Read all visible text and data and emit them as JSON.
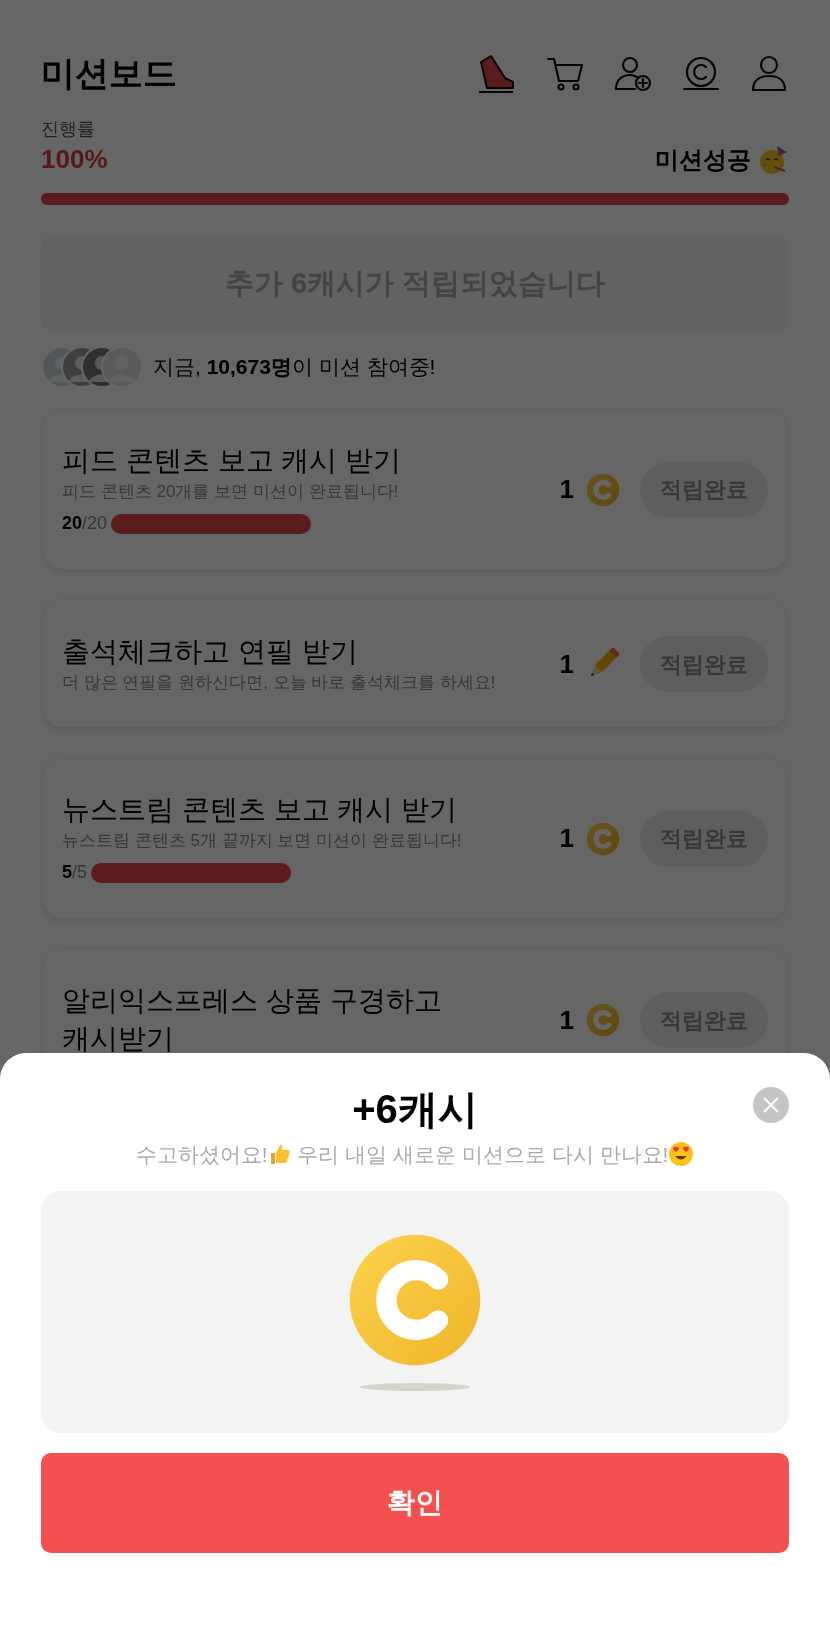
{
  "header": {
    "title": "미션보드"
  },
  "progress": {
    "label": "진행률",
    "value": "100%",
    "status": "미션성공",
    "level": 1
  },
  "banner": "추가 6캐시가 적립되었습니다",
  "participants": "지금, **10,673명**이 미션 참여중!",
  "missions": [
    {
      "title": "피드 콘텐츠 보고 캐시 받기",
      "description": "피드 콘텐츠 20개를 보면 미션이 완료됩니다!",
      "progress": {
        "done": "20",
        "total": "/20",
        "level": 1
      },
      "reward": {
        "amount": "1",
        "kind": "coin"
      },
      "button": "적립완료"
    },
    {
      "title": "출석체크하고 연필 받기",
      "description": "더 많은 연필을 원하신다면, 오늘 바로 출석체크를 하세요!",
      "reward": {
        "amount": "1",
        "kind": "pencil"
      },
      "button": "적립완료"
    },
    {
      "title": "뉴스트림 콘텐츠 보고 캐시 받기",
      "description": "뉴스트림 콘텐츠 5개 끝까지 보면 미션이 완료됩니다!",
      "progress": {
        "done": "5",
        "total": "/5",
        "level": 1
      },
      "reward": {
        "amount": "1",
        "kind": "coin"
      },
      "button": "적립완료"
    },
    {
      "title": "알리익스프레스 상품 구경하고 캐시받기",
      "reward": {
        "amount": "1",
        "kind": "coin"
      },
      "button": "적립완료"
    }
  ],
  "sheet": {
    "title": "+6캐시",
    "message": [
      {
        "kind": "text",
        "text": "수고하셨어요!"
      },
      {
        "kind": "thumbs-up"
      },
      {
        "kind": "text",
        "text": " 우리 내일 새로운 미션으로 다시 만나요!"
      },
      {
        "kind": "heart-eyes"
      }
    ],
    "button": "확인"
  }
}
